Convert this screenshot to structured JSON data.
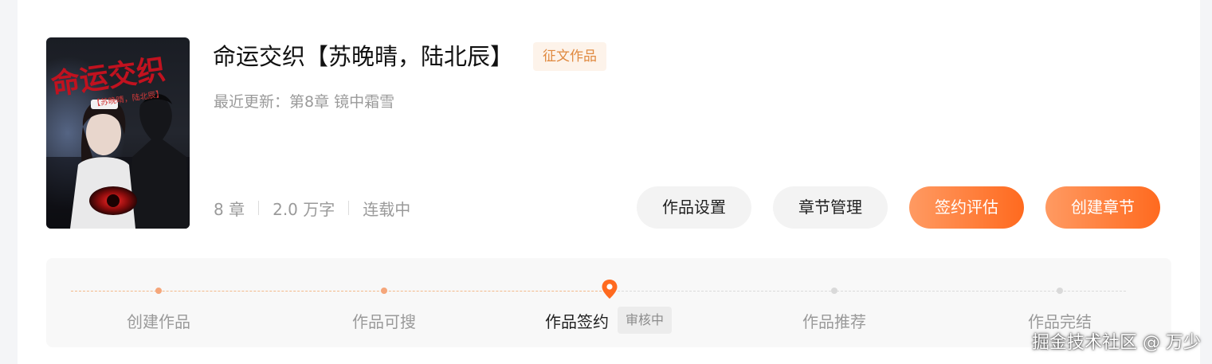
{
  "book": {
    "title": "命运交织【苏晚晴，陆北辰】",
    "tag": "征文作品",
    "latest_label": "最近更新：",
    "latest_chapter": "第8章 镜中霜雪",
    "stats": {
      "chapters": "8 章",
      "words": "2.0 万字",
      "status": "连载中"
    },
    "cover": {
      "title_text": "命运交织",
      "subtitle_text": "【苏晚晴，陆北辰】"
    }
  },
  "actions": {
    "settings": "作品设置",
    "chapter_manage": "章节管理",
    "sign_eval": "签约评估",
    "create_chapter": "创建章节"
  },
  "progress": {
    "steps": [
      {
        "label": "创建作品",
        "state": "done"
      },
      {
        "label": "作品可搜",
        "state": "done"
      },
      {
        "label": "作品签约",
        "state": "current"
      },
      {
        "label": "作品推荐",
        "state": "todo"
      },
      {
        "label": "作品完结",
        "state": "todo"
      }
    ],
    "current_badge": "审核中"
  },
  "watermark": "掘金技术社区 @ 万少",
  "colors": {
    "accent": "#ff6a1f",
    "accent_light": "#ff9a62",
    "tag_text": "#e0893f",
    "tag_bg": "#fdf3ea"
  }
}
